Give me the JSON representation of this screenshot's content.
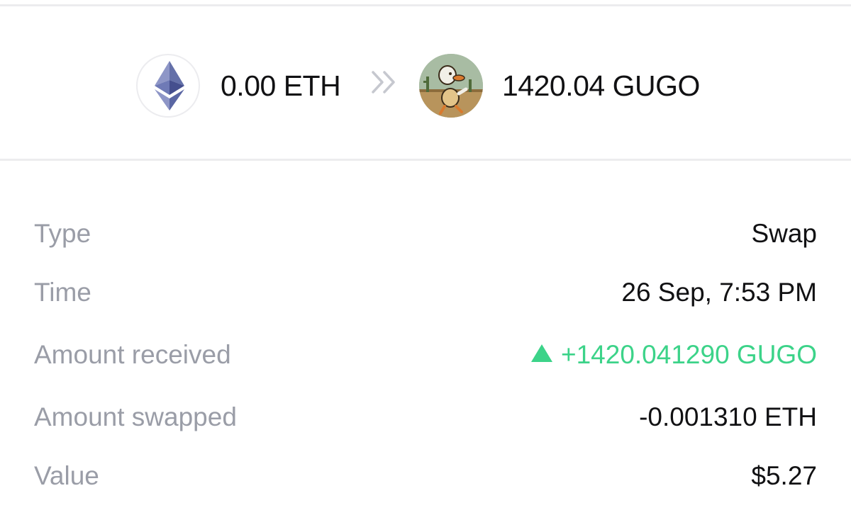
{
  "swap": {
    "from_token": {
      "icon": "ethereum-icon",
      "amount": "0.00 ETH"
    },
    "arrow_icon": "double-chevron-right-icon",
    "to_token": {
      "icon": "gugo-duck-avatar-icon",
      "amount": "1420.04 GUGO"
    }
  },
  "details": {
    "type": {
      "label": "Type",
      "value": "Swap"
    },
    "time": {
      "label": "Time",
      "value": "26 Sep, 7:53 PM"
    },
    "received": {
      "label": "Amount received",
      "value": "+1420.041290 GUGO",
      "icon": "up-triangle-icon"
    },
    "swapped": {
      "label": "Amount swapped",
      "value": "-0.001310 ETH"
    },
    "value": {
      "label": "Value",
      "value": "$5.27"
    }
  },
  "colors": {
    "positive": "#3cd389",
    "label": "#9a9da7",
    "text": "#111113",
    "divider": "#ececee"
  }
}
